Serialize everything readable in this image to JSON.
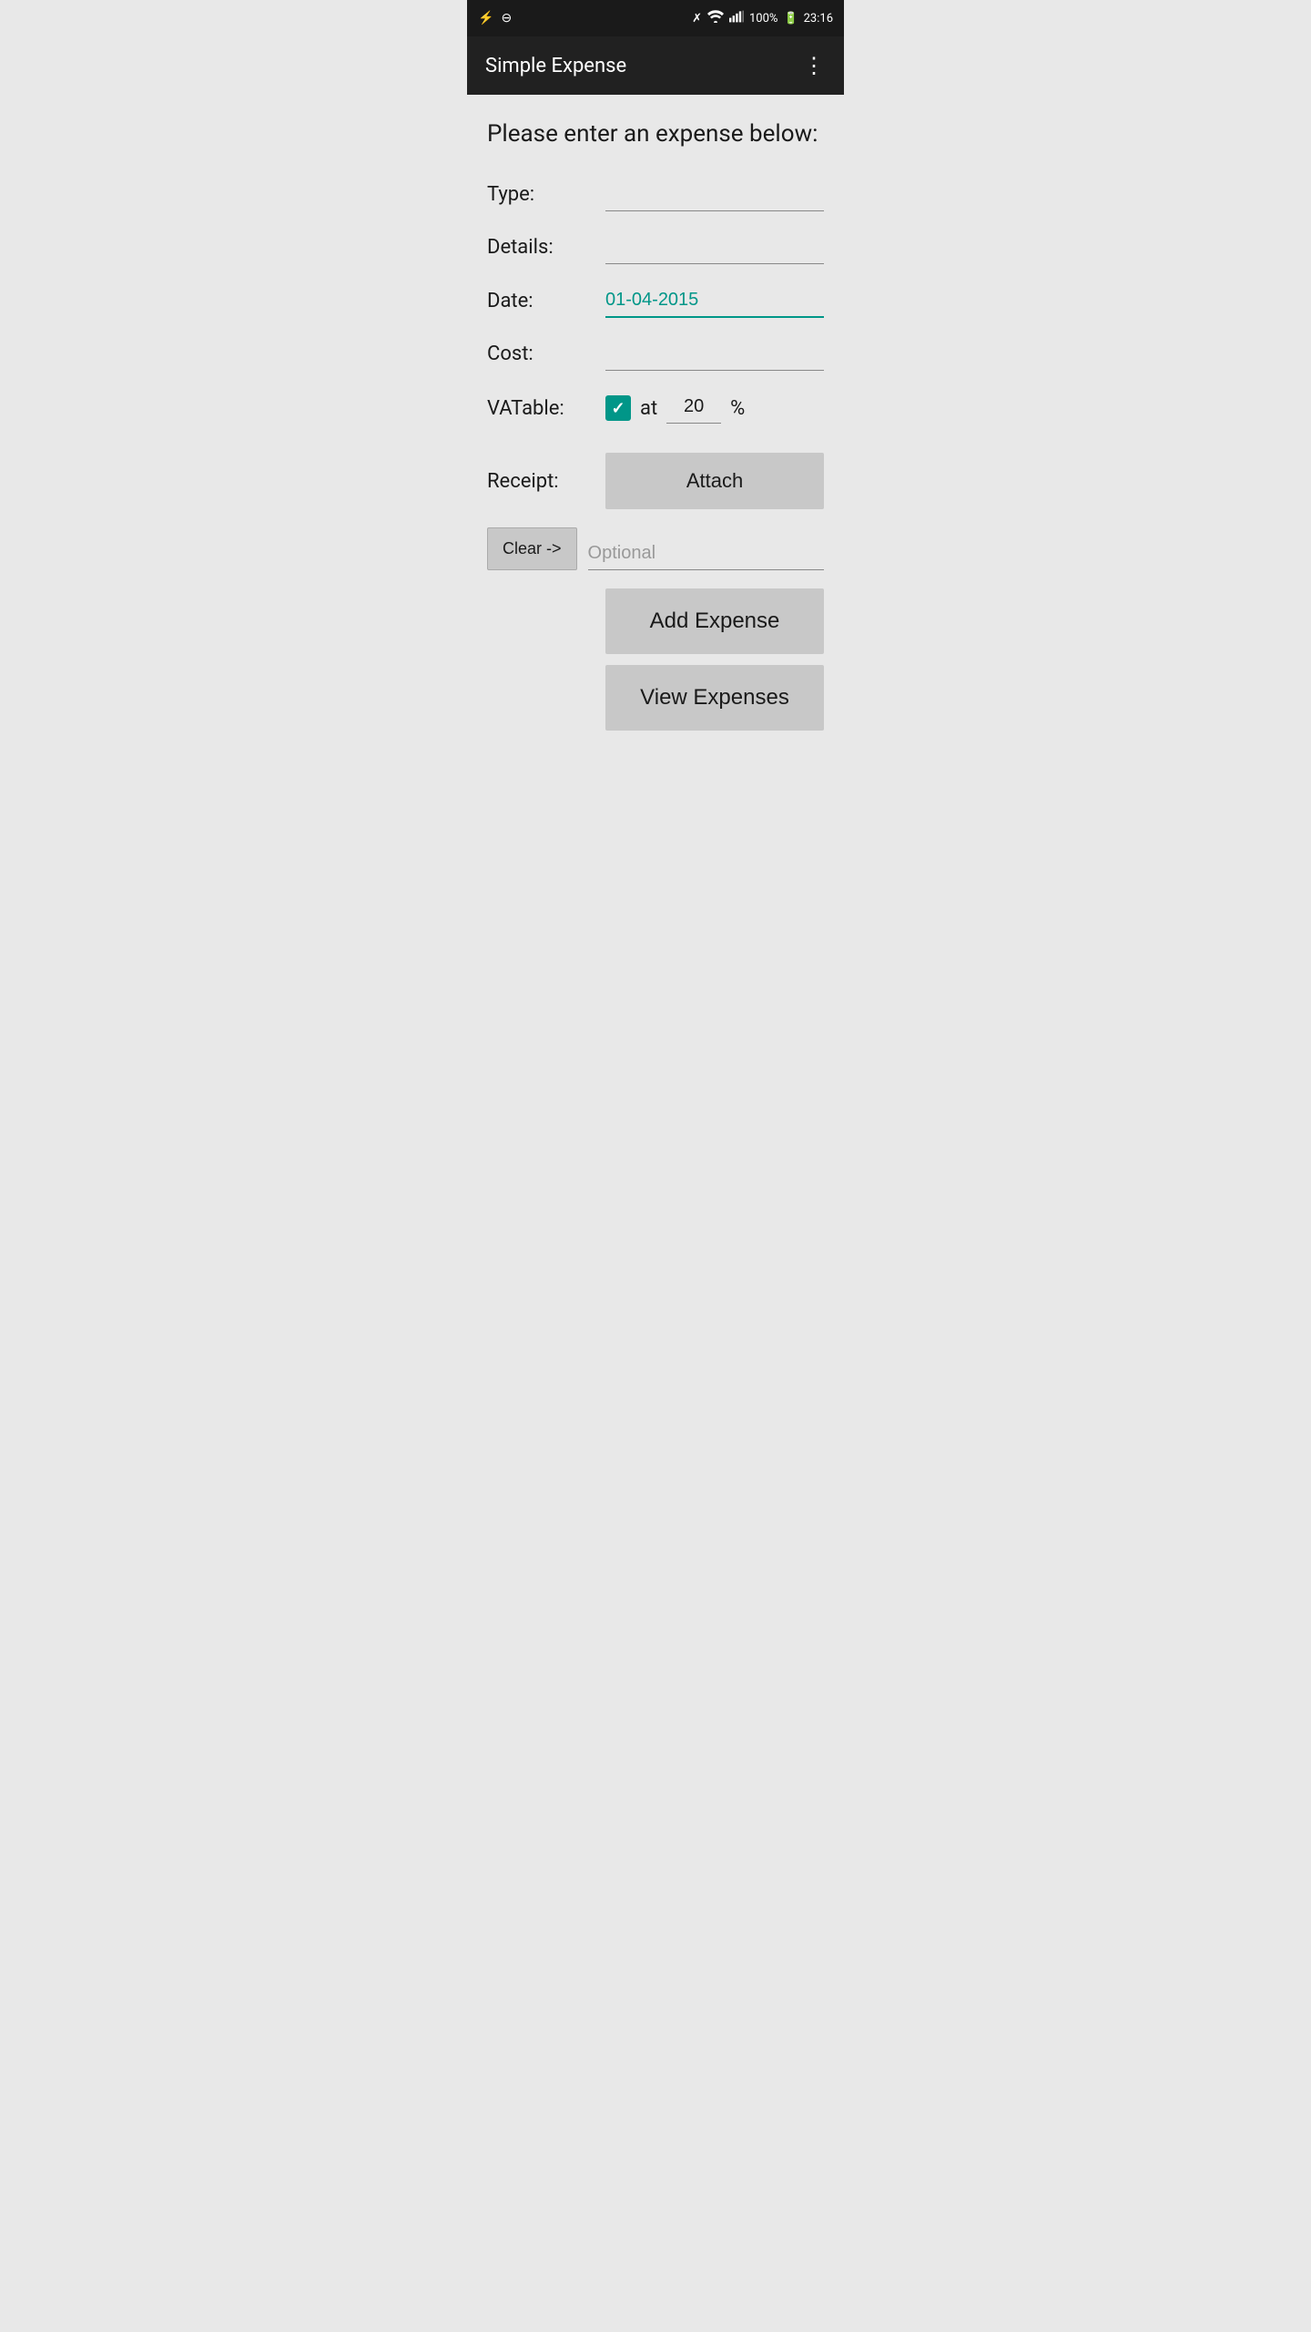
{
  "statusBar": {
    "leftIcons": [
      "usb-icon",
      "minus-circle-icon"
    ],
    "bluetooth": "⚑",
    "wifi": "wifi",
    "signal": "signal",
    "battery": "100%",
    "time": "23:16"
  },
  "appBar": {
    "title": "Simple Expense",
    "overflowIcon": "⋮"
  },
  "form": {
    "heading": "Please enter an expense below:",
    "typeLabel": "Type:",
    "typeValue": "",
    "detailsLabel": "Details:",
    "detailsValue": "",
    "dateLabel": "Date:",
    "dateValue": "01-04-2015",
    "costLabel": "Cost:",
    "costValue": "",
    "vatableLabel": "VATable:",
    "vatableChecked": true,
    "atText": "at",
    "vatRate": "20",
    "percentSymbol": "%",
    "receiptLabel": "Receipt:",
    "attachLabel": "Attach",
    "clearLabel": "Clear ->",
    "optionalPlaceholder": "Optional",
    "addExpenseLabel": "Add Expense",
    "viewExpensesLabel": "View Expenses"
  }
}
